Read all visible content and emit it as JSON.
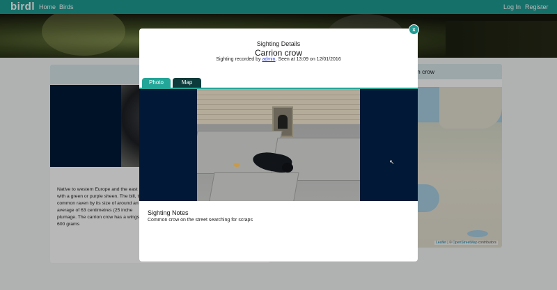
{
  "navbar": {
    "brand": "birdl",
    "links": [
      "Home",
      "Birds"
    ],
    "right_links": [
      "Log In",
      "Register"
    ]
  },
  "page": {
    "right_card_title": "n crow",
    "description": "Native to western Europe and the east with a green or purple sheen. The bill, the common raven by its size of around an average of 63 centimetres (25 inche plumage. The carrion crow has a wings 600 grams",
    "map_attribution": {
      "leaflet": "Leaflet",
      "separator": " | © ",
      "osm": "OpenStreetMap",
      "suffix": " contributors"
    }
  },
  "modal": {
    "close_label": "x",
    "subtitle": "Sighting Details",
    "title": "Carrion crow",
    "recorded_prefix": "Sighting recorded by ",
    "recorded_user": "admin",
    "recorded_suffix": ". Seen at 13:09 on 12/01/2016",
    "tabs": [
      {
        "label": "Photo",
        "active": true
      },
      {
        "label": "Map",
        "active": false
      }
    ],
    "notes_title": "Sighting Notes",
    "notes_text": "Common crow on the street searching for scraps"
  },
  "colors": {
    "accent": "#1f9c93",
    "dark_tab": "#0d3a3a",
    "photo_bg": "#011936"
  }
}
